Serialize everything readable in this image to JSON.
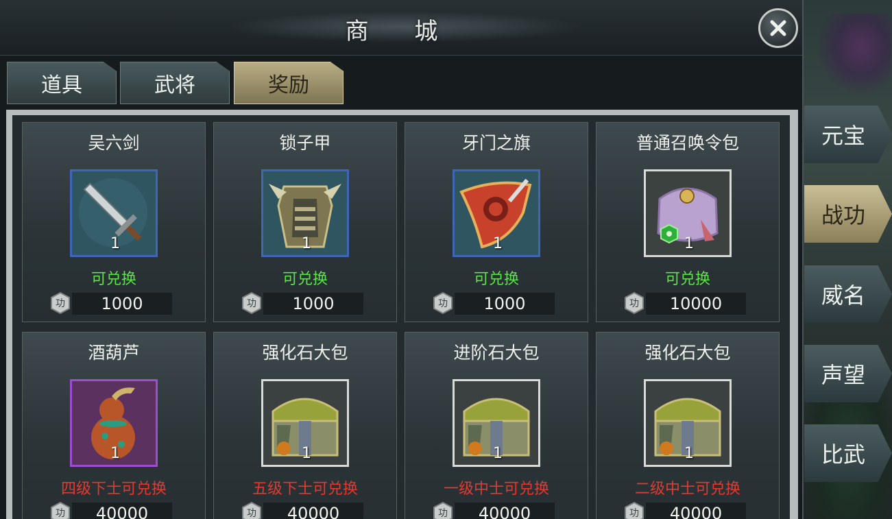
{
  "title": "商  城",
  "tabs": [
    {
      "label": "道具"
    },
    {
      "label": "武将"
    },
    {
      "label": "奖励",
      "active": true
    }
  ],
  "side_menu": [
    {
      "label": "元宝"
    },
    {
      "label": "战功",
      "active": true
    },
    {
      "label": "威名"
    },
    {
      "label": "声望"
    },
    {
      "label": "比武"
    }
  ],
  "currency_icon": "merit-coin-icon",
  "items": [
    {
      "name": "吴六剑",
      "qty": "1",
      "status": "可兑换",
      "status_type": "ok",
      "price": "1000",
      "icon": "sword-icon",
      "rarity": "blue"
    },
    {
      "name": "锁子甲",
      "qty": "1",
      "status": "可兑换",
      "status_type": "ok",
      "price": "1000",
      "icon": "armor-icon",
      "rarity": "blue"
    },
    {
      "name": "牙门之旗",
      "qty": "1",
      "status": "可兑换",
      "status_type": "ok",
      "price": "1000",
      "icon": "banner-icon",
      "rarity": "blue"
    },
    {
      "name": "普通召唤令包",
      "qty": "1",
      "status": "可兑换",
      "status_type": "ok",
      "price": "10000",
      "icon": "summon-bag-icon",
      "rarity": "white"
    },
    {
      "name": "酒葫芦",
      "qty": "1",
      "status": "四级下士可兑换",
      "status_type": "locked",
      "price": "40000",
      "icon": "gourd-icon",
      "rarity": "purple"
    },
    {
      "name": "强化石大包",
      "qty": "1",
      "status": "五级下士可兑换",
      "status_type": "locked",
      "price": "40000",
      "icon": "chest-icon",
      "rarity": "white"
    },
    {
      "name": "进阶石大包",
      "qty": "1",
      "status": "一级中士可兑换",
      "status_type": "locked",
      "price": "40000",
      "icon": "chest-icon",
      "rarity": "white"
    },
    {
      "name": "强化石大包",
      "qty": "1",
      "status": "二级中士可兑换",
      "status_type": "locked",
      "price": "40000",
      "icon": "chest-icon",
      "rarity": "white"
    }
  ]
}
